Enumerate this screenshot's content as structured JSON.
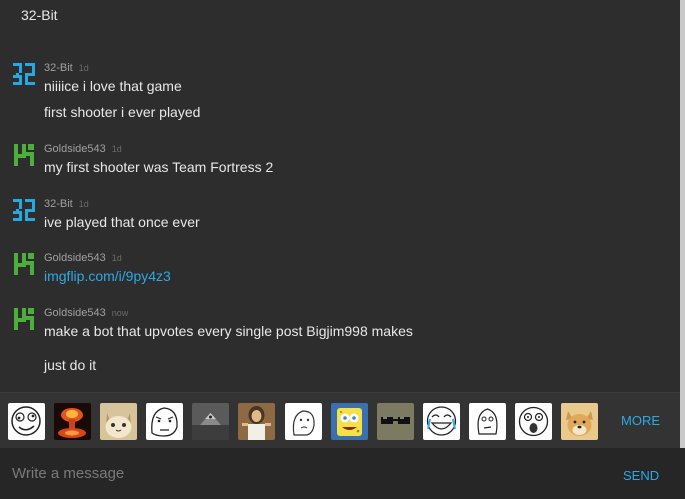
{
  "header": {
    "title": "32-Bit"
  },
  "messages": [
    {
      "user": "32-Bit",
      "avatar": "32-bit-avatar-icon",
      "time": "1d",
      "lines": [
        "niiiice i love that game",
        "first shooter i ever played"
      ]
    },
    {
      "user": "Goldside543",
      "avatar": "goldside-avatar-icon",
      "time": "1d",
      "lines": [
        "my first shooter was Team Fortress 2"
      ]
    },
    {
      "user": "32-Bit",
      "avatar": "32-bit-avatar-icon",
      "time": "1d",
      "lines": [
        "ive played that once ever"
      ]
    },
    {
      "user": "Goldside543",
      "avatar": "goldside-avatar-icon",
      "time": "1d",
      "lines": [
        "imgflip.com/i/9py4z3"
      ]
    },
    {
      "user": "Goldside543",
      "avatar": "goldside-avatar-icon",
      "time": "now",
      "lines": [
        "make a bot that upvotes every single post Bigjim998 makes",
        "just do it"
      ]
    }
  ],
  "emoji_bar": {
    "items": [
      "derp-face-icon",
      "nuke-explosion-icon",
      "cat-icon",
      "okay-face-icon",
      "illuminati-icon",
      "jesus-icon",
      "feels-guy-icon",
      "spongebob-icon",
      "cool-glasses-icon",
      "cry-laugh-face-icon",
      "hmm-face-icon",
      "omg-face-icon",
      "doge-icon"
    ],
    "more_label": "MORE"
  },
  "input": {
    "placeholder": "Write a message",
    "value": "",
    "send_label": "SEND"
  },
  "colors": {
    "background": "#2d2d2d",
    "link": "#2ea8e6",
    "avatar_32bit": "#29a8e0",
    "avatar_goldside": "#4caf3c"
  }
}
